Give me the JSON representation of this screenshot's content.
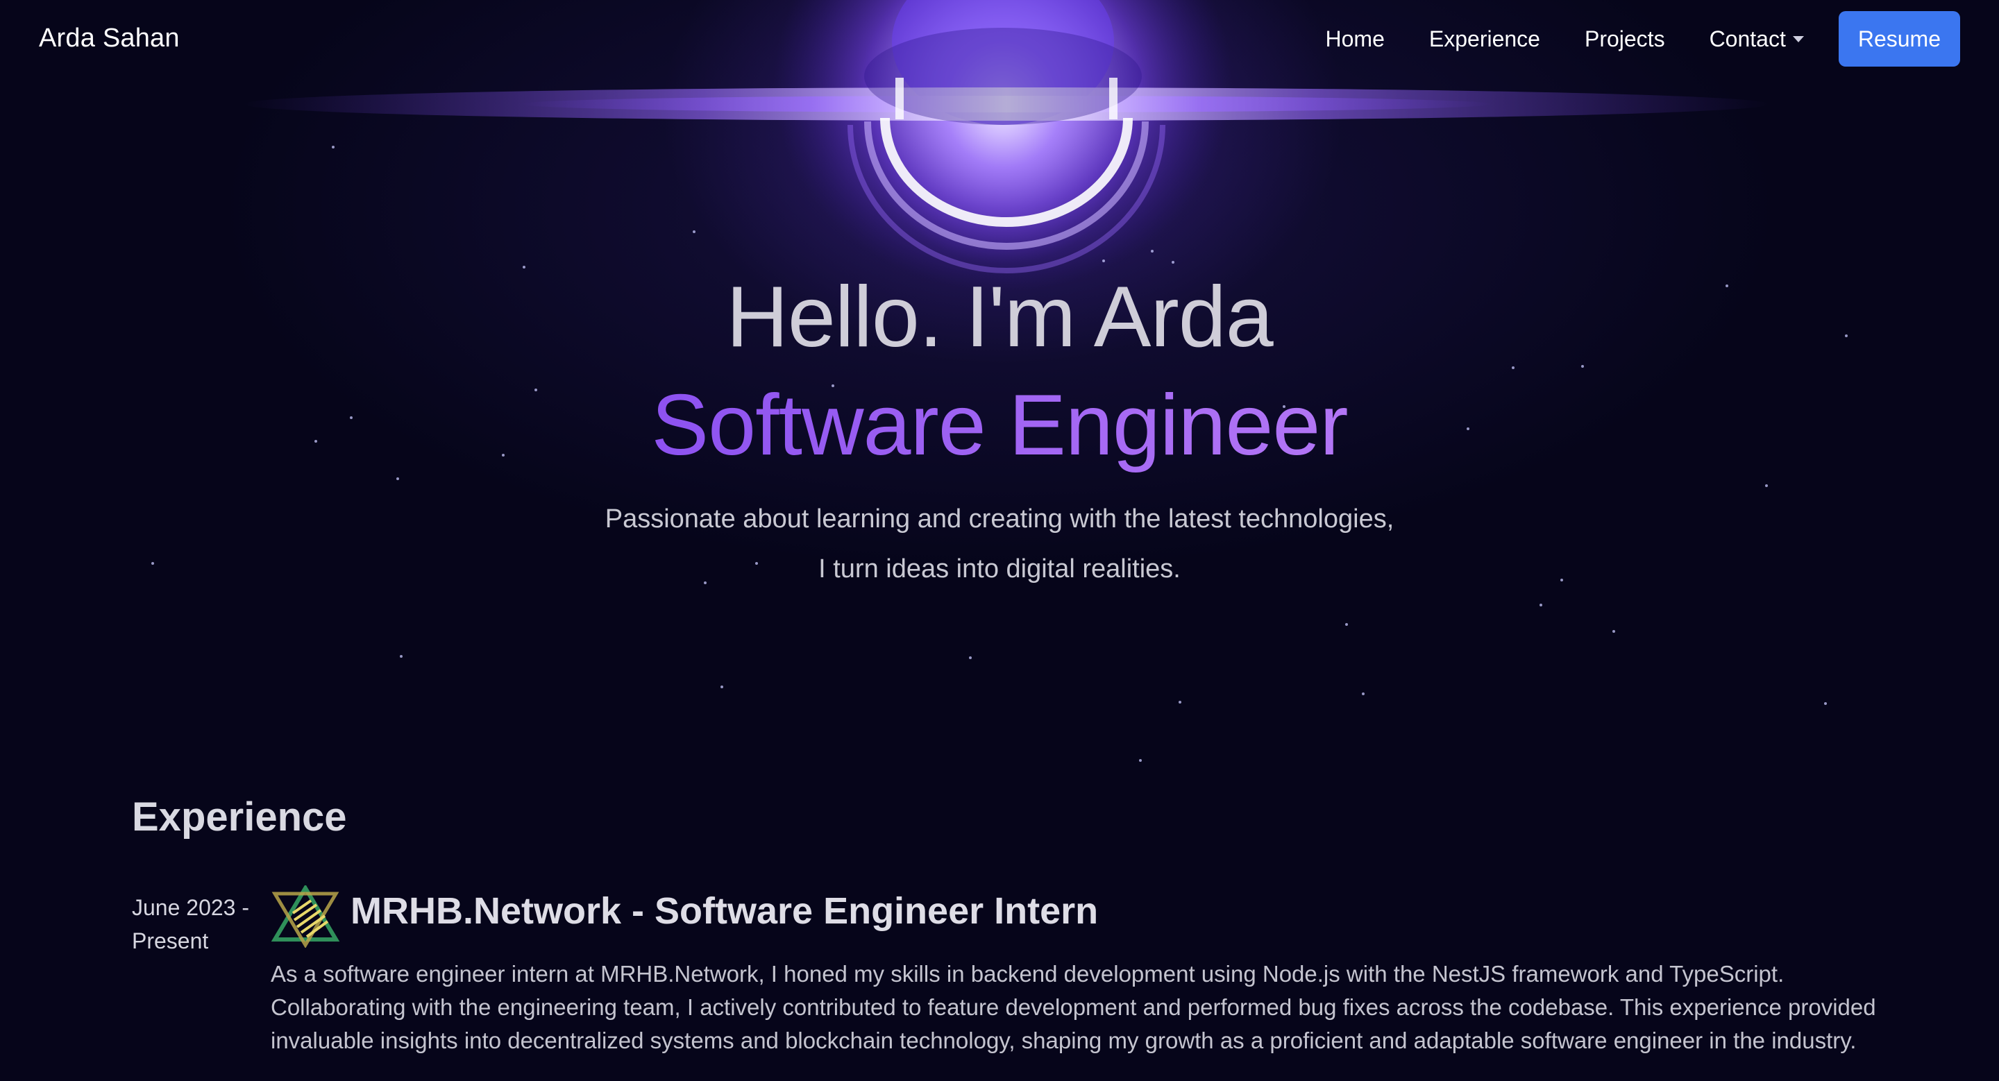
{
  "nav": {
    "brand": "Arda Sahan",
    "links": [
      {
        "label": "Home"
      },
      {
        "label": "Experience"
      },
      {
        "label": "Projects"
      },
      {
        "label": "Contact"
      }
    ],
    "resume_label": "Resume"
  },
  "hero": {
    "greeting": "Hello. I'm Arda",
    "role": "Software Engineer",
    "tagline_line1": "Passionate about learning and creating with the latest technologies,",
    "tagline_line2": "I turn ideas into digital realities."
  },
  "experience": {
    "section_title": "Experience",
    "items": [
      {
        "date_line1": "June 2023 -",
        "date_line2": "Present",
        "logo_icon": "mrhb-logo-icon",
        "title": "MRHB.Network - Software Engineer Intern",
        "description": "As a software engineer intern at MRHB.Network, I honed my skills in backend development using Node.js with the NestJS framework and TypeScript. Collaborating with the engineering team, I actively contributed to feature development and performed bug fixes across the codebase. This experience provided invaluable insights into decentralized systems and blockchain technology, shaping my growth as a proficient and adaptable software engineer in the industry."
      }
    ]
  },
  "colors": {
    "background": "#06051a",
    "accent_purple": "#8a4ff0",
    "resume_button": "#3b76f0"
  }
}
